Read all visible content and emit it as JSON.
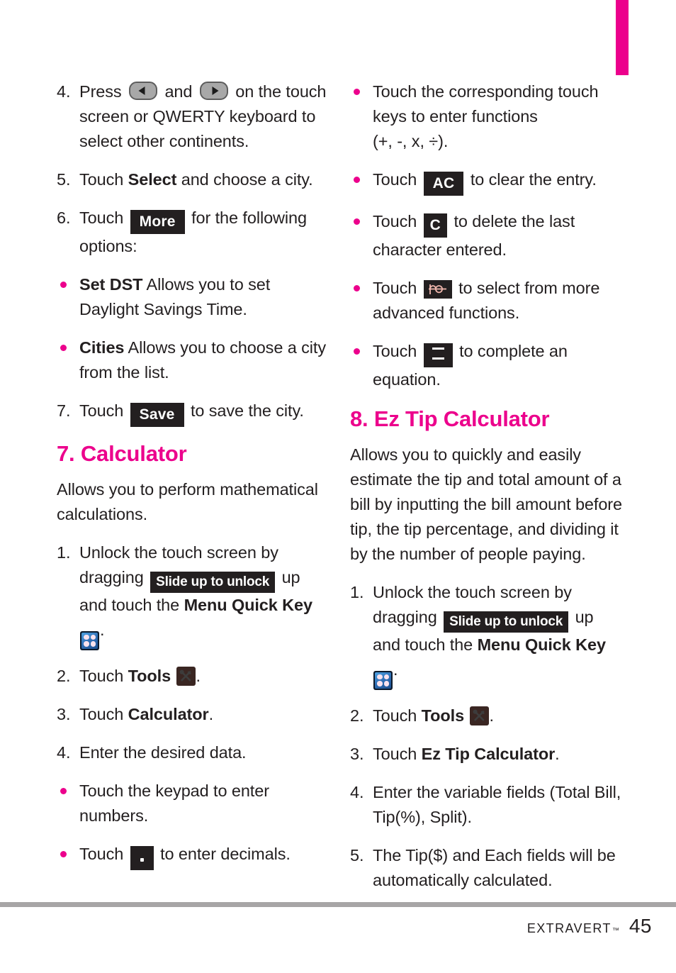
{
  "page": {
    "number": "45",
    "brand": "Extravert",
    "trademark": "™",
    "accent_color": "#ec008c",
    "text_color": "#231f20",
    "rule_color": "#a7a5a6"
  },
  "left_column": {
    "step4": {
      "num": "4.",
      "text_before": "Press",
      "text_middle": "and",
      "text_after": "on the touch screen or QWERTY keyboard to select other continents.",
      "icon_left": "arrow-left-key",
      "icon_right": "arrow-right-key"
    },
    "step5": {
      "num": "5.",
      "text_before": "Touch",
      "bold": "Select",
      "text_after": "and choose a city."
    },
    "step6": {
      "num": "6.",
      "text_before": "Touch",
      "key": "More",
      "text_after": "for the following options:"
    },
    "bullet_set_dst": {
      "bold": "Set DST",
      "text": "Allows you to set Daylight Savings Time."
    },
    "bullet_cities": {
      "bold": "Cities",
      "text": "Allows you to choose a city from the list."
    },
    "step7": {
      "num": "7.",
      "text_before": "Touch",
      "key": "Save",
      "text_after": "to save the city."
    },
    "heading_calculator": "7. Calculator",
    "intro": "Allows you to perform mathematical calculations.",
    "calc_step1": {
      "num": "1.",
      "text_before": "Unlock the touch screen by dragging",
      "key": "Slide up to unlock",
      "text_middle": "up and touch the",
      "bold": "Menu Quick Key",
      "icon": "menu-quick-key-icon",
      "text_after": "."
    },
    "calc_step2": {
      "num": "2.",
      "text_before": "Touch",
      "bold": "Tools",
      "icon": "tools-icon",
      "text_after": "."
    },
    "calc_step3": {
      "num": "3.",
      "text_before": "Touch",
      "bold": "Calculator",
      "text_after": "."
    },
    "calc_step4": {
      "num": "4.",
      "text": "Enter the desired data."
    },
    "bullet_keypad": {
      "text": "Touch the keypad to enter numbers."
    },
    "bullet_decimal": {
      "text_before": "Touch",
      "key": ".",
      "text_after": "to enter decimals."
    }
  },
  "right_column": {
    "bullet_functions": {
      "text": "Touch the corresponding touch keys to enter functions",
      "text_line3": "(+, -, x, ÷)."
    },
    "bullet_ac": {
      "text_before": "Touch",
      "key": "AC",
      "text_after": "to clear the entry."
    },
    "bullet_c": {
      "text_before": "Touch",
      "key": "C",
      "text_after": "to delete the last character entered."
    },
    "bullet_advanced": {
      "text_before": "Touch",
      "icon": "sine-wave-function-icon",
      "text_after": "to select from more advanced functions."
    },
    "bullet_equals": {
      "text_before": "Touch",
      "key": "=",
      "text_after": "to complete an equation."
    },
    "heading_eztip": "8. Ez Tip Calculator",
    "intro": "Allows you to quickly and easily estimate the tip and total amount of a bill by inputting the bill amount before tip, the tip percentage, and dividing it by the number of people paying.",
    "tip_step1": {
      "num": "1.",
      "text_before": "Unlock the touch screen by dragging",
      "key": "Slide up to unlock",
      "text_middle": "up and touch the",
      "bold": "Menu Quick Key",
      "icon": "menu-quick-key-icon",
      "text_after": "."
    },
    "tip_step2": {
      "num": "2.",
      "text_before": "Touch",
      "bold": "Tools",
      "icon": "tools-icon",
      "text_after": "."
    },
    "tip_step3": {
      "num": "3.",
      "text_before": "Touch",
      "bold": "Ez Tip Calculator",
      "text_after": "."
    },
    "tip_step4": {
      "num": "4.",
      "text": "Enter the variable fields (Total Bill, Tip(%), Split)."
    },
    "tip_step5": {
      "num": "5.",
      "text": "The Tip($) and Each fields will be automatically calculated."
    }
  }
}
